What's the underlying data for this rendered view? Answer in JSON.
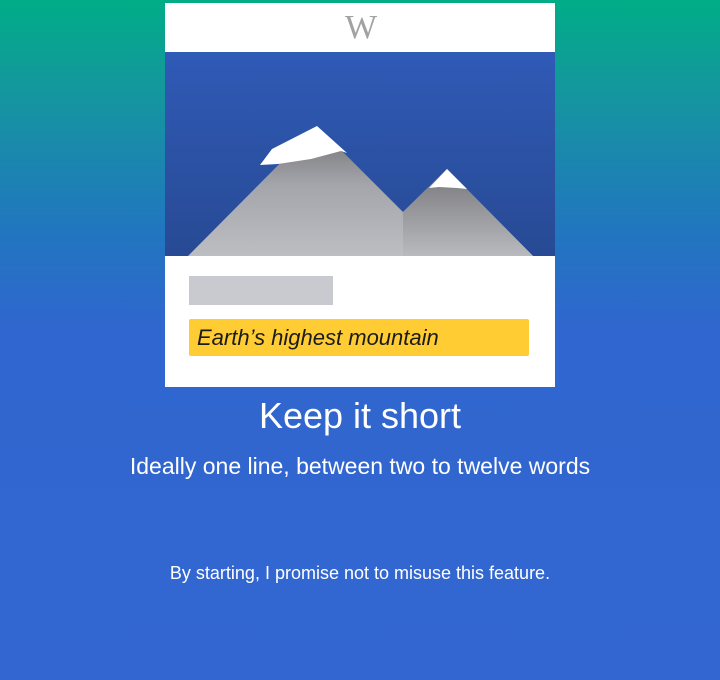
{
  "card": {
    "logo_letter": "W",
    "illustration": "mountain-illustration",
    "description_text": "Earth’s highest mountain"
  },
  "onboarding": {
    "heading": "Keep it short",
    "subheading": "Ideally one line, between two to twelve words",
    "promise_text": "By starting, I promise not to misuse this feature."
  },
  "colors": {
    "background_top": "#00ad87",
    "background_bottom": "#3366d0",
    "sky": "#2b54a5",
    "highlight": "#ffcc33",
    "placeholder": "#c8cacf"
  }
}
